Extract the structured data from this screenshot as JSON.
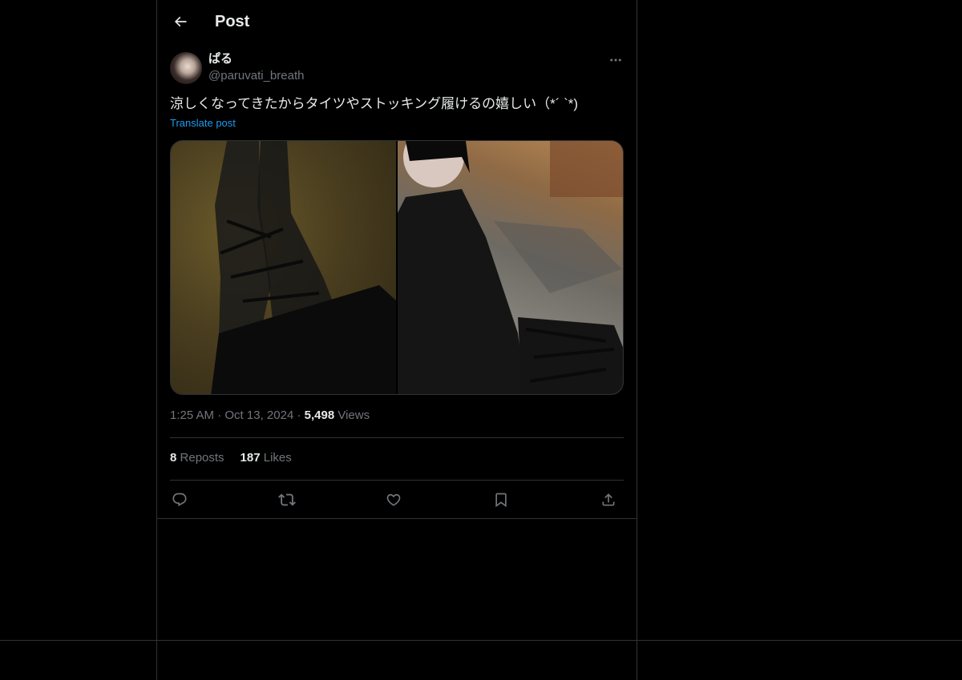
{
  "header": {
    "title": "Post",
    "back_icon": "arrow-left-icon"
  },
  "post": {
    "author": {
      "display_name": "ぱる",
      "handle": "@paruvati_breath"
    },
    "text": "涼しくなってきたからタイツやストッキング履けるの嬉しい（*´ `*)",
    "translate_label": "Translate post",
    "media_count": 2,
    "meta": {
      "time": "1:25 AM",
      "separator": "·",
      "date": "Oct 13, 2024",
      "views_count": "5,498",
      "views_label": "Views"
    },
    "stats": {
      "reposts_count": "8",
      "reposts_label": "Reposts",
      "likes_count": "187",
      "likes_label": "Likes"
    },
    "actions": {
      "reply_icon": "reply-icon",
      "repost_icon": "repost-icon",
      "like_icon": "heart-icon",
      "bookmark_icon": "bookmark-icon",
      "share_icon": "share-icon"
    }
  },
  "colors": {
    "background": "#000000",
    "text_primary": "#e7e9ea",
    "text_secondary": "#71767b",
    "accent": "#1d9bf0",
    "border": "#2f3336"
  }
}
